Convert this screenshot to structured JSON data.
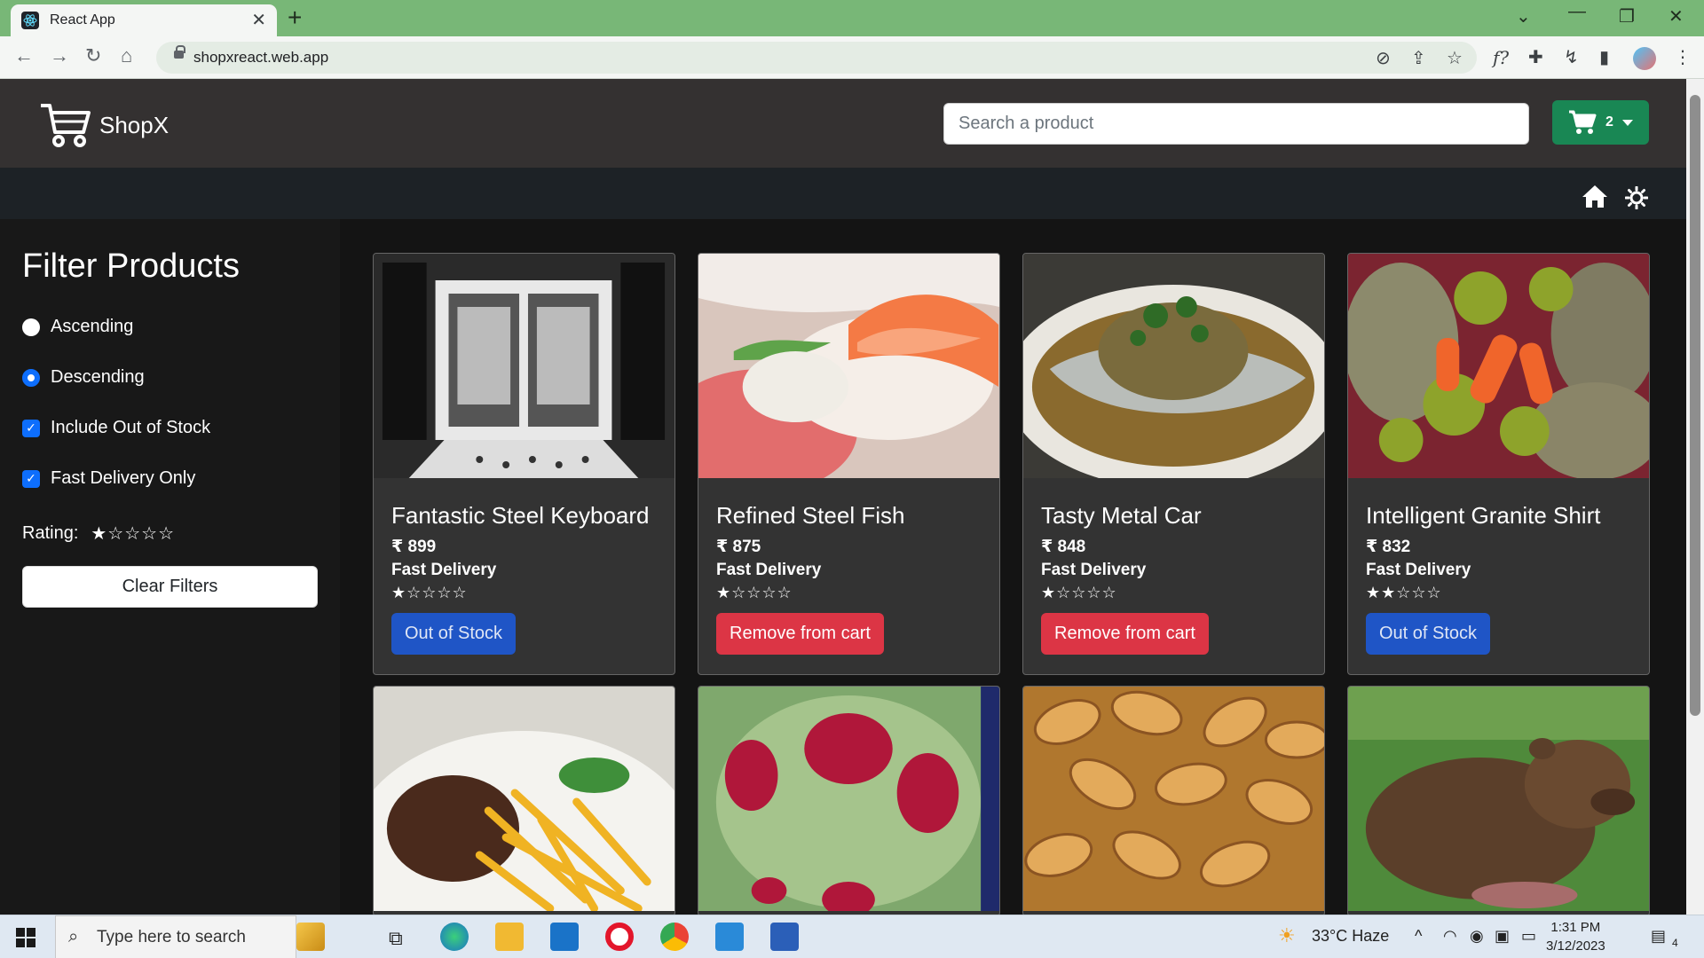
{
  "browser": {
    "tab_title": "React App",
    "url": "shopxreact.web.app"
  },
  "header": {
    "brand": "ShopX",
    "search_placeholder": "Search a product",
    "cart_count": "2"
  },
  "filters": {
    "title": "Filter Products",
    "ascending": "Ascending",
    "descending": "Descending",
    "include_out_of_stock": "Include Out of Stock",
    "fast_delivery_only": "Fast Delivery Only",
    "rating_label": "Rating:",
    "rating_value": 1,
    "rating_max": 5,
    "selected_sort": "Descending",
    "include_out_of_stock_checked": true,
    "fast_delivery_checked": true,
    "clear_label": "Clear Filters"
  },
  "products": [
    {
      "name": "Fantastic Steel Keyboard",
      "price": "₹ 899",
      "delivery": "Fast Delivery",
      "rating": 1,
      "rating_max": 5,
      "action": "Out of Stock",
      "action_type": "oos"
    },
    {
      "name": "Refined Steel Fish",
      "price": "₹ 875",
      "delivery": "Fast Delivery",
      "rating": 1,
      "rating_max": 5,
      "action": "Remove from cart",
      "action_type": "remove"
    },
    {
      "name": "Tasty Metal Car",
      "price": "₹ 848",
      "delivery": "Fast Delivery",
      "rating": 1,
      "rating_max": 5,
      "action": "Remove from cart",
      "action_type": "remove"
    },
    {
      "name": "Intelligent Granite Shirt",
      "price": "₹ 832",
      "delivery": "Fast Delivery",
      "rating": 2,
      "rating_max": 5,
      "action": "Out of Stock",
      "action_type": "oos"
    }
  ],
  "taskbar": {
    "search_placeholder": "Type here to search",
    "weather": "33°C  Haze",
    "time": "1:31 PM",
    "date": "3/12/2023",
    "notifications": "4"
  }
}
